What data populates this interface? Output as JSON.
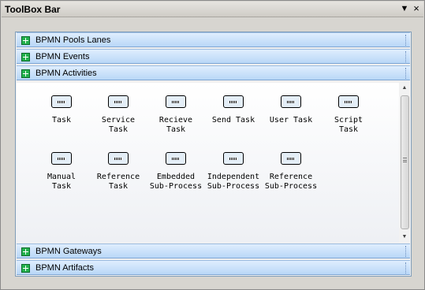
{
  "window": {
    "title": "ToolBox Bar",
    "menu_icon": "▼",
    "close_icon": "×"
  },
  "sections_top": [
    {
      "label": "BPMN Pools Lanes",
      "icon": "expand-plus-icon"
    },
    {
      "label": "BPMN Events",
      "icon": "expand-plus-icon"
    },
    {
      "label": "BPMN Activities",
      "icon": "expand-plus-icon"
    }
  ],
  "activities": [
    {
      "label": "Task"
    },
    {
      "label": "Service\nTask"
    },
    {
      "label": "Recieve\nTask"
    },
    {
      "label": "Send Task"
    },
    {
      "label": "User Task"
    },
    {
      "label": "Script\nTask"
    },
    {
      "label": "Manual\nTask"
    },
    {
      "label": "Reference\nTask"
    },
    {
      "label": "Embedded\nSub-Process"
    },
    {
      "label": "Independent\nSub-Process"
    },
    {
      "label": "Reference\nSub-Process"
    }
  ],
  "sections_bottom": [
    {
      "label": "BPMN Gateways",
      "icon": "expand-plus-icon"
    },
    {
      "label": "BPMN Artifacts",
      "icon": "expand-plus-icon"
    }
  ],
  "scrollbar": {
    "up_arrow": "▲",
    "down_arrow": "▼"
  },
  "colors": {
    "header_top": "#dfeefe",
    "header_bottom": "#b9d7f7",
    "plus_icon": "#22b14c"
  }
}
